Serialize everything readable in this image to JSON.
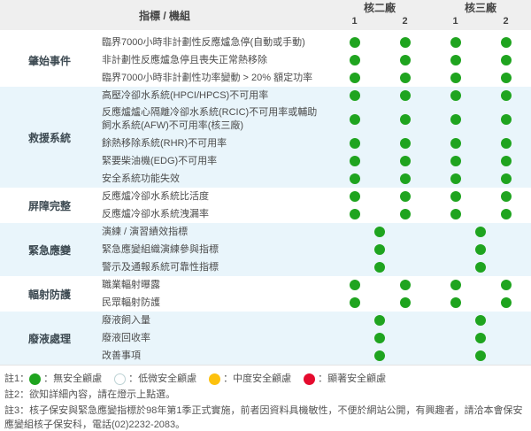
{
  "colors": {
    "green": "#1fa41f",
    "low": "#ffffff",
    "low_border": "#bcd2d4",
    "yellow": "#fdc10d",
    "red": "#e50b2e"
  },
  "header": {
    "indicator_label": "指標 / 機組",
    "plants": [
      {
        "name": "核二廠",
        "units": [
          "1",
          "2"
        ]
      },
      {
        "name": "核三廠",
        "units": [
          "1",
          "2"
        ]
      }
    ]
  },
  "groups": [
    {
      "name": "肇始事件",
      "rows": [
        {
          "label": "臨界7000小時非計劃性反應爐急停(自動或手動)",
          "scope": "unit",
          "dots": [
            "green",
            "green",
            "green",
            "green"
          ]
        },
        {
          "label": "非計劃性反應爐急停且喪失正常熱移除",
          "scope": "unit",
          "dots": [
            "green",
            "green",
            "green",
            "green"
          ]
        },
        {
          "label": "臨界7000小時非計劃性功率變動 > 20% 額定功率",
          "scope": "unit",
          "dots": [
            "green",
            "green",
            "green",
            "green"
          ]
        }
      ]
    },
    {
      "name": "救援系統",
      "rows": [
        {
          "label": "高壓冷卻水系統(HPCI/HPCS)不可用率",
          "scope": "unit",
          "dots": [
            "green",
            "green",
            "green",
            "green"
          ]
        },
        {
          "label": "反應爐爐心隔離冷卻水系統(RCIC)不可用率或輔助飼水系統(AFW)不可用率(核三廠)",
          "scope": "unit",
          "dots": [
            "green",
            "green",
            "green",
            "green"
          ]
        },
        {
          "label": "餘熱移除系統(RHR)不可用率",
          "scope": "unit",
          "dots": [
            "green",
            "green",
            "green",
            "green"
          ]
        },
        {
          "label": "緊要柴油機(EDG)不可用率",
          "scope": "unit",
          "dots": [
            "green",
            "green",
            "green",
            "green"
          ]
        },
        {
          "label": "安全系統功能失效",
          "scope": "unit",
          "dots": [
            "green",
            "green",
            "green",
            "green"
          ]
        }
      ]
    },
    {
      "name": "屏障完整",
      "rows": [
        {
          "label": "反應爐冷卻水系統比活度",
          "scope": "unit",
          "dots": [
            "green",
            "green",
            "green",
            "green"
          ]
        },
        {
          "label": "反應爐冷卻水系統洩漏率",
          "scope": "unit",
          "dots": [
            "green",
            "green",
            "green",
            "green"
          ]
        }
      ]
    },
    {
      "name": "緊急應變",
      "rows": [
        {
          "label": "演練 / 演習績效指標",
          "scope": "plant",
          "dots": [
            "green",
            "green"
          ]
        },
        {
          "label": "緊急應變組織演練參與指標",
          "scope": "plant",
          "dots": [
            "green",
            "green"
          ]
        },
        {
          "label": "警示及通報系統可靠性指標",
          "scope": "plant",
          "dots": [
            "green",
            "green"
          ]
        }
      ]
    },
    {
      "name": "輻射防護",
      "rows": [
        {
          "label": "職業輻射曝露",
          "scope": "unit",
          "dots": [
            "green",
            "green",
            "green",
            "green"
          ]
        },
        {
          "label": "民眾輻射防護",
          "scope": "unit",
          "dots": [
            "green",
            "green",
            "green",
            "green"
          ]
        }
      ]
    },
    {
      "name": "廢液處理",
      "rows": [
        {
          "label": "廢液飼入量",
          "scope": "plant",
          "dots": [
            "green",
            "green"
          ]
        },
        {
          "label": "廢液回收率",
          "scope": "plant",
          "dots": [
            "green",
            "green"
          ]
        },
        {
          "label": "改善事項",
          "scope": "plant",
          "dots": [
            "green",
            "green"
          ]
        }
      ]
    }
  ],
  "legend": {
    "separator": "：",
    "items": [
      {
        "id": "green",
        "label": "無安全顧慮"
      },
      {
        "id": "low",
        "label": "低微安全顧慮"
      },
      {
        "id": "yellow",
        "label": "中度安全顧慮"
      },
      {
        "id": "red",
        "label": "顯著安全顧慮"
      }
    ]
  },
  "notes": {
    "note1_prefix": "註1：",
    "note2": "註2：欲知詳細內容，請在燈示上點選。",
    "note3": "註3：核子保安與緊急應變指標於98年第1季正式實施，前者因資料具機敏性，不便於網站公開，有興趣者，請洽本會保安應變組核子保安科，電話(02)2232-2083。"
  }
}
